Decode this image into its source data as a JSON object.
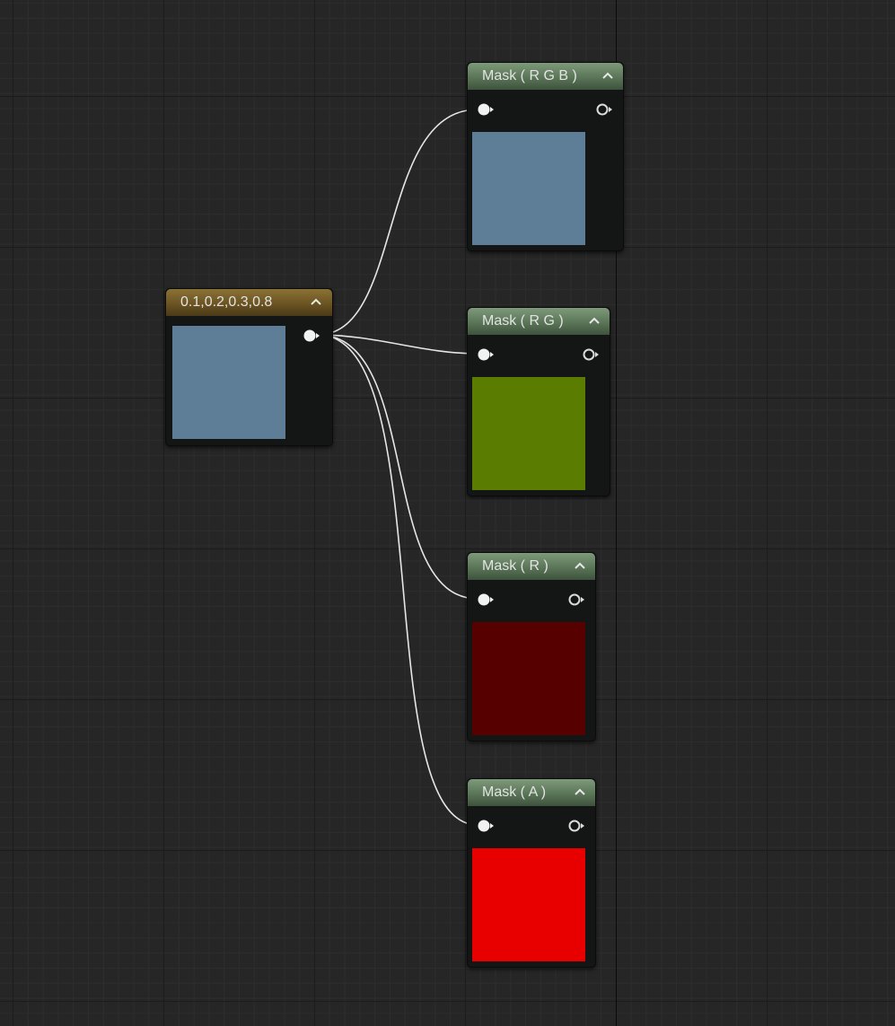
{
  "constant_node": {
    "title": "0.1,0.2,0.3,0.8",
    "preview_color": "#5e7e98"
  },
  "mask_nodes": [
    {
      "title": "Mask ( R G B )",
      "preview_color": "#5e7e98"
    },
    {
      "title": "Mask ( R G )",
      "preview_color": "#5a7c00"
    },
    {
      "title": "Mask ( R )",
      "preview_color": "#560000"
    },
    {
      "title": "Mask ( A )",
      "preview_color": "#e80000"
    }
  ],
  "colors": {
    "constant_header": "#6b5422",
    "mask_header": "#5a7557",
    "node_body": "#141515",
    "graph_background": "#262626",
    "wire": "#e6e6e6"
  }
}
